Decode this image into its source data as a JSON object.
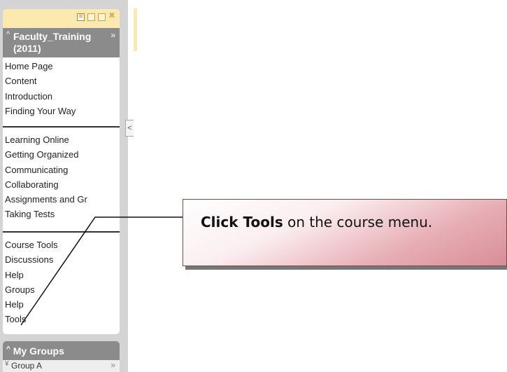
{
  "view_toolbar": {
    "icons": [
      "list-view-icon",
      "folder-view-icon",
      "window-view-icon",
      "pin-icon"
    ]
  },
  "course": {
    "title": "Faculty_Training\n(2011)",
    "collapse_caret": "^",
    "expand_arrow": "»"
  },
  "menu": {
    "section1": [
      "Home Page",
      "Content",
      "Introduction",
      "Finding Your Way"
    ],
    "section2": [
      "Learning Online",
      "Getting Organized",
      "Communicating",
      "Collaborating",
      "Assignments and Gr",
      "Taking Tests"
    ],
    "section3": [
      "Course Tools",
      "Discussions",
      "Help",
      "Groups",
      "Help",
      "Tools"
    ]
  },
  "my_groups": {
    "title": "My Groups",
    "items": [
      {
        "label": "Group A"
      }
    ]
  },
  "collapse_tab": "<",
  "callout": {
    "bold": "Click Tools",
    "rest": " on the course menu."
  }
}
